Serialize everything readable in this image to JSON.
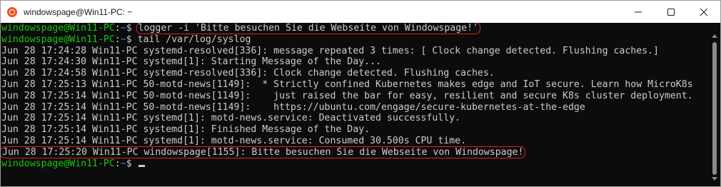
{
  "window": {
    "title": "windowspage@Win11-PC: ~",
    "icon": "ubuntu-icon",
    "controls": [
      "minimize-icon",
      "maximize-icon",
      "close-icon"
    ]
  },
  "terminal": {
    "prompt_user": "windowspage@Win11-PC",
    "prompt_sep": ":",
    "prompt_path": "~",
    "prompt_sym": "$",
    "lines": [
      {
        "type": "prompt",
        "cmd": "logger -i 'Bitte besuchen Sie die Webseite von Windowspage!'",
        "highlight": true
      },
      {
        "type": "prompt",
        "cmd": "tail /var/log/syslog"
      },
      {
        "type": "out",
        "text": "Jun 28 17:24:28 Win11-PC systemd-resolved[336]: message repeated 3 times: [ Clock change detected. Flushing caches.]"
      },
      {
        "type": "out",
        "text": "Jun 28 17:24:30 Win11-PC systemd[1]: Starting Message of the Day..."
      },
      {
        "type": "out",
        "text": "Jun 28 17:24:58 Win11-PC systemd-resolved[336]: Clock change detected. Flushing caches."
      },
      {
        "type": "out",
        "text": "Jun 28 17:25:13 Win11-PC 50-motd-news[1149]:  * Strictly confined Kubernetes makes edge and IoT secure. Learn how MicroK8s"
      },
      {
        "type": "out",
        "text": "Jun 28 17:25:14 Win11-PC 50-motd-news[1149]:    just raised the bar for easy, resilient and secure K8s cluster deployment."
      },
      {
        "type": "out",
        "text": "Jun 28 17:25:14 Win11-PC 50-motd-news[1149]:    https://ubuntu.com/engage/secure-kubernetes-at-the-edge"
      },
      {
        "type": "out",
        "text": "Jun 28 17:25:14 Win11-PC systemd[1]: motd-news.service: Deactivated successfully."
      },
      {
        "type": "out",
        "text": "Jun 28 17:25:14 Win11-PC systemd[1]: Finished Message of the Day."
      },
      {
        "type": "out",
        "text": "Jun 28 17:25:14 Win11-PC systemd[1]: motd-news.service: Consumed 30.500s CPU time."
      },
      {
        "type": "out",
        "text": "Jun 28 17:25:20 Win11-PC windowspage[1155]: Bitte besuchen Sie die Webseite von Windowspage!",
        "highlight": true
      },
      {
        "type": "prompt",
        "cmd": "",
        "cursor": true
      }
    ]
  },
  "colors": {
    "background": "#0c0c0c",
    "prompt_user": "#16c60c",
    "prompt_path": "#3b78ff",
    "text": "#cccccc",
    "highlight_border": "#e0241c"
  }
}
